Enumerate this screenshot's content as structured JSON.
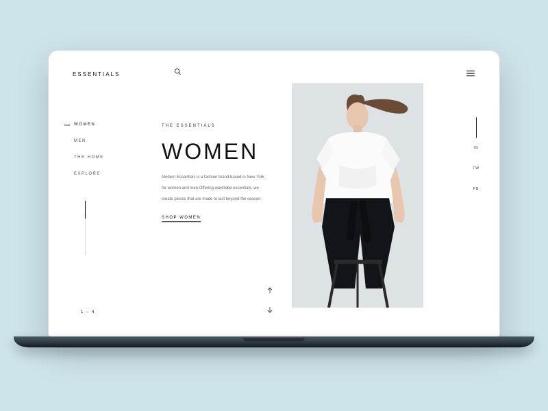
{
  "header": {
    "logo": "ESSENTIALS"
  },
  "sidebar": {
    "items": [
      {
        "label": "WOMEN"
      },
      {
        "label": "MEN"
      },
      {
        "label": "THE HOME"
      },
      {
        "label": "EXPLORE"
      }
    ]
  },
  "content": {
    "eyebrow": "THE ESSENTIALS",
    "heading": "WOMEN",
    "body1": "Modern Essentials is a fashion brand based in New York",
    "body2": "for women and men.Offering wardrobe essentials, we",
    "body3": "create pieces that are made to last beyond the season.",
    "cta": "SHOP WOMEN"
  },
  "pagination": {
    "label": "1 – 4"
  },
  "social": {
    "items": [
      {
        "label": "IG"
      },
      {
        "label": "TW"
      },
      {
        "label": "FB"
      }
    ]
  }
}
